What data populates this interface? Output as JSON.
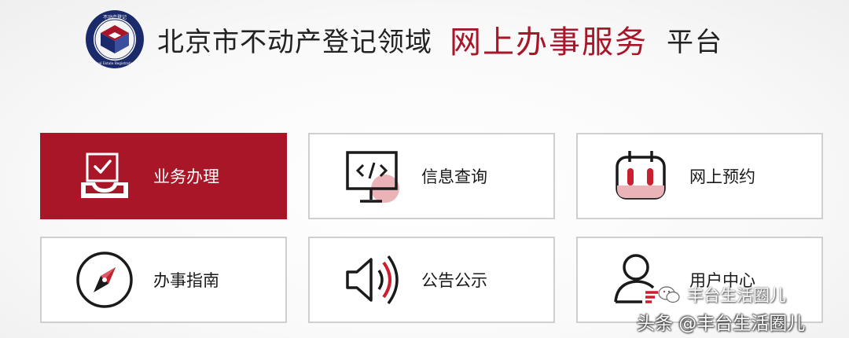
{
  "header": {
    "logo_text": "不动产登记 Real Estate Registration",
    "title_main": "北京市不动产登记领域",
    "title_highlight": "网上办事服务",
    "title_tail": "平台"
  },
  "tiles": [
    {
      "label": "业务办理",
      "icon": "inbox-check-icon",
      "active": true
    },
    {
      "label": "信息查询",
      "icon": "monitor-code-icon",
      "active": false
    },
    {
      "label": "网上预约",
      "icon": "calendar-icon",
      "active": false
    },
    {
      "label": "办事指南",
      "icon": "compass-icon",
      "active": false
    },
    {
      "label": "公告公示",
      "icon": "speaker-icon",
      "active": false
    },
    {
      "label": "用户中心",
      "icon": "user-icon",
      "active": false
    }
  ],
  "watermark": {
    "wechat_label": "丰台生活圈儿",
    "footer_label": "头条 @丰台生活圈儿"
  },
  "colors": {
    "brand_red": "#a91628",
    "border_gray": "#cfcfcf"
  }
}
